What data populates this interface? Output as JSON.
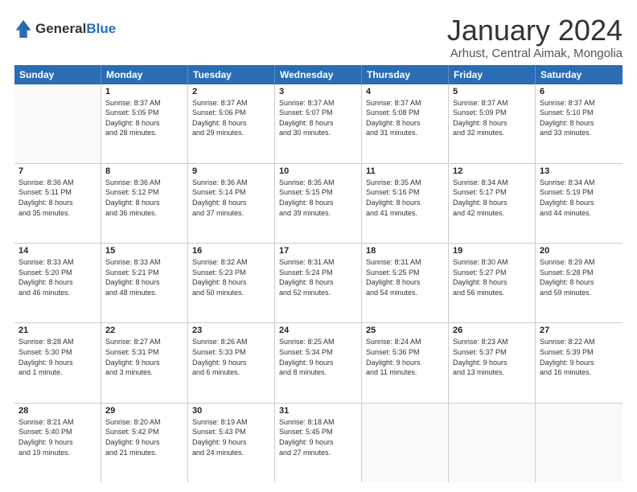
{
  "header": {
    "logo_general": "General",
    "logo_blue": "Blue",
    "month_title": "January 2024",
    "subtitle": "Arhust, Central Aimak, Mongolia"
  },
  "days_of_week": [
    "Sunday",
    "Monday",
    "Tuesday",
    "Wednesday",
    "Thursday",
    "Friday",
    "Saturday"
  ],
  "weeks": [
    [
      {
        "day": "",
        "info": ""
      },
      {
        "day": "1",
        "info": "Sunrise: 8:37 AM\nSunset: 5:05 PM\nDaylight: 8 hours\nand 28 minutes."
      },
      {
        "day": "2",
        "info": "Sunrise: 8:37 AM\nSunset: 5:06 PM\nDaylight: 8 hours\nand 29 minutes."
      },
      {
        "day": "3",
        "info": "Sunrise: 8:37 AM\nSunset: 5:07 PM\nDaylight: 8 hours\nand 30 minutes."
      },
      {
        "day": "4",
        "info": "Sunrise: 8:37 AM\nSunset: 5:08 PM\nDaylight: 8 hours\nand 31 minutes."
      },
      {
        "day": "5",
        "info": "Sunrise: 8:37 AM\nSunset: 5:09 PM\nDaylight: 8 hours\nand 32 minutes."
      },
      {
        "day": "6",
        "info": "Sunrise: 8:37 AM\nSunset: 5:10 PM\nDaylight: 8 hours\nand 33 minutes."
      }
    ],
    [
      {
        "day": "7",
        "info": "Sunrise: 8:36 AM\nSunset: 5:11 PM\nDaylight: 8 hours\nand 35 minutes."
      },
      {
        "day": "8",
        "info": "Sunrise: 8:36 AM\nSunset: 5:12 PM\nDaylight: 8 hours\nand 36 minutes."
      },
      {
        "day": "9",
        "info": "Sunrise: 8:36 AM\nSunset: 5:14 PM\nDaylight: 8 hours\nand 37 minutes."
      },
      {
        "day": "10",
        "info": "Sunrise: 8:35 AM\nSunset: 5:15 PM\nDaylight: 8 hours\nand 39 minutes."
      },
      {
        "day": "11",
        "info": "Sunrise: 8:35 AM\nSunset: 5:16 PM\nDaylight: 8 hours\nand 41 minutes."
      },
      {
        "day": "12",
        "info": "Sunrise: 8:34 AM\nSunset: 5:17 PM\nDaylight: 8 hours\nand 42 minutes."
      },
      {
        "day": "13",
        "info": "Sunrise: 8:34 AM\nSunset: 5:19 PM\nDaylight: 8 hours\nand 44 minutes."
      }
    ],
    [
      {
        "day": "14",
        "info": "Sunrise: 8:33 AM\nSunset: 5:20 PM\nDaylight: 8 hours\nand 46 minutes."
      },
      {
        "day": "15",
        "info": "Sunrise: 8:33 AM\nSunset: 5:21 PM\nDaylight: 8 hours\nand 48 minutes."
      },
      {
        "day": "16",
        "info": "Sunrise: 8:32 AM\nSunset: 5:23 PM\nDaylight: 8 hours\nand 50 minutes."
      },
      {
        "day": "17",
        "info": "Sunrise: 8:31 AM\nSunset: 5:24 PM\nDaylight: 8 hours\nand 52 minutes."
      },
      {
        "day": "18",
        "info": "Sunrise: 8:31 AM\nSunset: 5:25 PM\nDaylight: 8 hours\nand 54 minutes."
      },
      {
        "day": "19",
        "info": "Sunrise: 8:30 AM\nSunset: 5:27 PM\nDaylight: 8 hours\nand 56 minutes."
      },
      {
        "day": "20",
        "info": "Sunrise: 8:29 AM\nSunset: 5:28 PM\nDaylight: 8 hours\nand 59 minutes."
      }
    ],
    [
      {
        "day": "21",
        "info": "Sunrise: 8:28 AM\nSunset: 5:30 PM\nDaylight: 9 hours\nand 1 minute."
      },
      {
        "day": "22",
        "info": "Sunrise: 8:27 AM\nSunset: 5:31 PM\nDaylight: 9 hours\nand 3 minutes."
      },
      {
        "day": "23",
        "info": "Sunrise: 8:26 AM\nSunset: 5:33 PM\nDaylight: 9 hours\nand 6 minutes."
      },
      {
        "day": "24",
        "info": "Sunrise: 8:25 AM\nSunset: 5:34 PM\nDaylight: 9 hours\nand 8 minutes."
      },
      {
        "day": "25",
        "info": "Sunrise: 8:24 AM\nSunset: 5:36 PM\nDaylight: 9 hours\nand 11 minutes."
      },
      {
        "day": "26",
        "info": "Sunrise: 8:23 AM\nSunset: 5:37 PM\nDaylight: 9 hours\nand 13 minutes."
      },
      {
        "day": "27",
        "info": "Sunrise: 8:22 AM\nSunset: 5:39 PM\nDaylight: 9 hours\nand 16 minutes."
      }
    ],
    [
      {
        "day": "28",
        "info": "Sunrise: 8:21 AM\nSunset: 5:40 PM\nDaylight: 9 hours\nand 19 minutes."
      },
      {
        "day": "29",
        "info": "Sunrise: 8:20 AM\nSunset: 5:42 PM\nDaylight: 9 hours\nand 21 minutes."
      },
      {
        "day": "30",
        "info": "Sunrise: 8:19 AM\nSunset: 5:43 PM\nDaylight: 9 hours\nand 24 minutes."
      },
      {
        "day": "31",
        "info": "Sunrise: 8:18 AM\nSunset: 5:45 PM\nDaylight: 9 hours\nand 27 minutes."
      },
      {
        "day": "",
        "info": ""
      },
      {
        "day": "",
        "info": ""
      },
      {
        "day": "",
        "info": ""
      }
    ]
  ]
}
